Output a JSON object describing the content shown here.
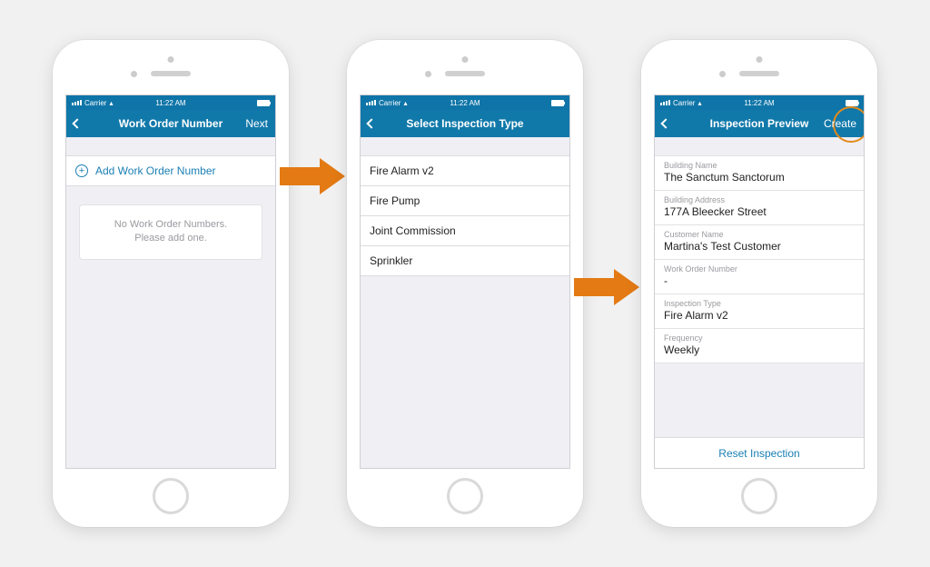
{
  "statusbar": {
    "carrier": "Carrier",
    "wifi": "▲",
    "time": "11:22 AM"
  },
  "screen1": {
    "title": "Work Order Number",
    "next": "Next",
    "add_label": "Add Work Order Number",
    "empty_line1": "No Work Order Numbers.",
    "empty_line2": "Please add one."
  },
  "screen2": {
    "title": "Select Inspection Type",
    "options": [
      "Fire Alarm v2",
      "Fire Pump",
      "Joint Commission",
      "Sprinkler"
    ]
  },
  "screen3": {
    "title": "Inspection Preview",
    "create": "Create",
    "fields": [
      {
        "label": "Building Name",
        "value": "The Sanctum Sanctorum"
      },
      {
        "label": "Building Address",
        "value": "177A Bleecker Street"
      },
      {
        "label": "Customer Name",
        "value": "Martina's Test Customer"
      },
      {
        "label": "Work Order Number",
        "value": "-"
      },
      {
        "label": "Inspection Type",
        "value": "Fire Alarm v2"
      },
      {
        "label": "Frequency",
        "value": "Weekly"
      }
    ],
    "reset": "Reset Inspection"
  }
}
